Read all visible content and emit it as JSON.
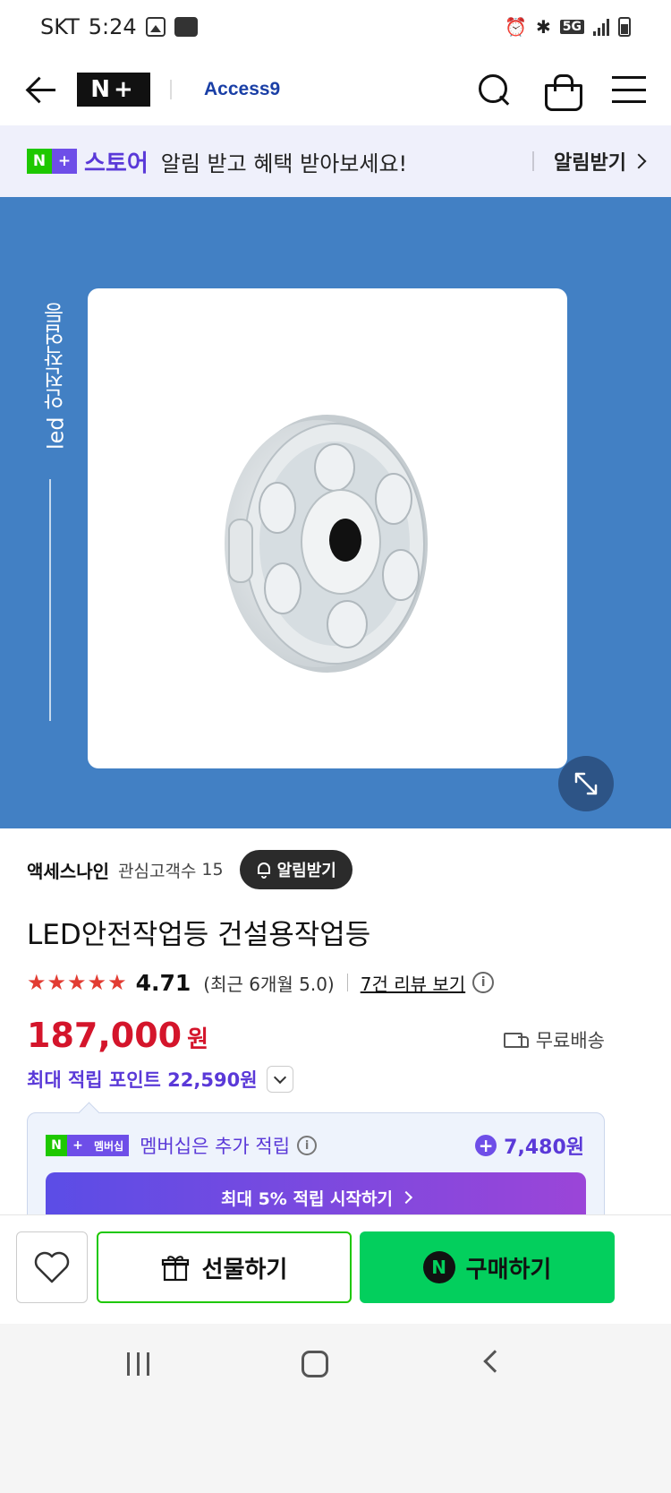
{
  "status_bar": {
    "carrier": "SKT",
    "time": "5:24",
    "network": "5G"
  },
  "header": {
    "store_logo": "N+",
    "brand_logo": "Access9"
  },
  "promo": {
    "logo_left": "N",
    "logo_right": "+",
    "store_name": "스토어",
    "message": "알림 받고 혜택 받아보세요!",
    "link_label": "알림받기"
  },
  "hero": {
    "vertical_label": "led 안전작업등"
  },
  "seller": {
    "name": "액세스나인",
    "fans_label": "관심고객수",
    "fans_count": "15",
    "alarm_label": "알림받기"
  },
  "product": {
    "title": "LED안전작업등 건설용작업등",
    "rating": {
      "stars": 5,
      "score": "4.71",
      "recent": "(최근 6개월 5.0)",
      "review_link": "7건 리뷰 보기"
    },
    "price": {
      "amount": "187,000",
      "unit": "원"
    },
    "shipping": "무료배송",
    "max_points": "최대 적립 포인트 22,590원"
  },
  "membership": {
    "badge_n": "N",
    "badge_plus": "+",
    "badge_text": "멤버십",
    "text": "멤버십은 추가 적립",
    "points": "7,480원",
    "cta": "최대 5% 적립 시작하기"
  },
  "bottom_bar": {
    "gift_label": "선물하기",
    "buy_label": "구매하기",
    "buy_icon_letter": "N"
  },
  "colors": {
    "hero_bg": "#4280c4",
    "price": "#d4152b",
    "accent_purple": "#5a39d8",
    "naver_green": "#03cf5d"
  }
}
